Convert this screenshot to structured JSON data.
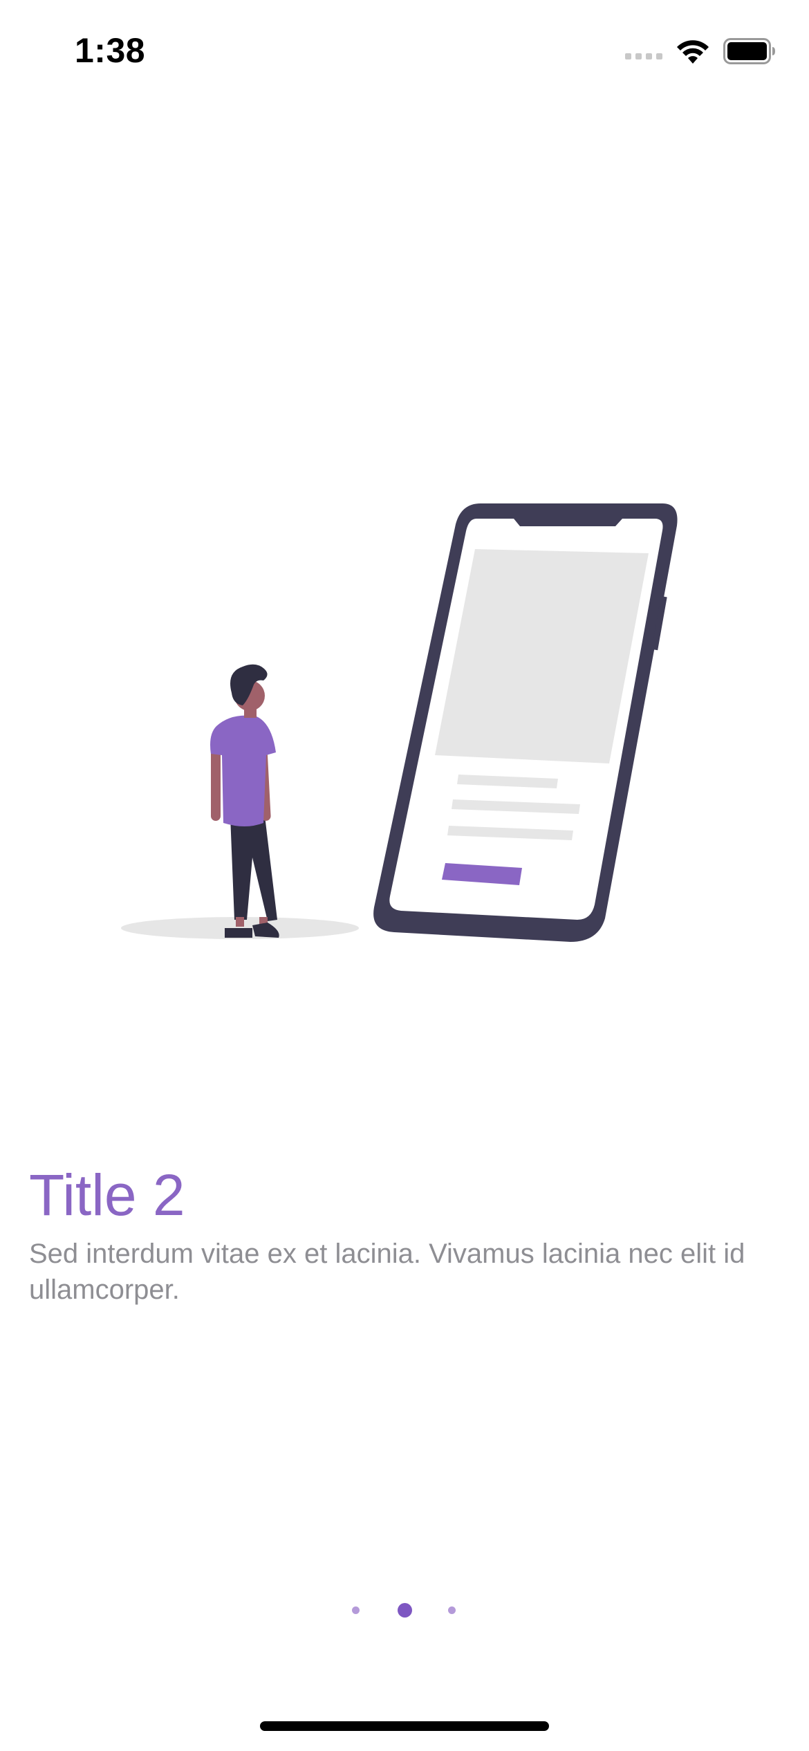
{
  "status_bar": {
    "time": "1:38"
  },
  "onboarding": {
    "title": "Title 2",
    "description": "Sed interdum vitae ex et lacinia. Vivamus lacinia nec elit id ullamcorper."
  },
  "page_indicator": {
    "total_pages": 3,
    "current_page": 2
  },
  "colors": {
    "accent": "#8a66c4",
    "accent_dark": "#7e57c2",
    "dot_inactive": "#b49ad9",
    "text_secondary": "#8e8e93",
    "phone_frame": "#3f3d56",
    "placeholder_gray": "#e6e6e6"
  },
  "icons": {
    "signal": "signal-icon",
    "wifi": "wifi-icon",
    "battery": "battery-icon",
    "illustration": "person-with-phone-illustration"
  }
}
